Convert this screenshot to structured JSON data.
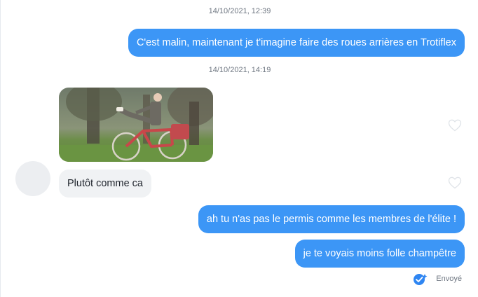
{
  "conversation": {
    "timestamps": [
      "14/10/2021, 12:39",
      "14/10/2021, 14:19"
    ],
    "messages": [
      {
        "direction": "outgoing",
        "text": "C'est malin, maintenant je t'imagine faire des roues arrières en Trotiflex"
      },
      {
        "direction": "incoming",
        "type": "gif",
        "description_icon": "bicycle-gif-image"
      },
      {
        "direction": "incoming",
        "text": "Plutôt comme ca"
      },
      {
        "direction": "outgoing",
        "text": "ah tu n'as pas le permis comme les membres de l'élite !"
      },
      {
        "direction": "outgoing",
        "text": "je te voyais moins folle champêtre"
      }
    ],
    "status": "Envoyé"
  },
  "colors": {
    "outgoing_bubble": "#3c96f6",
    "incoming_bubble": "#f0f2f4",
    "check_icon": "#2f86f2"
  }
}
